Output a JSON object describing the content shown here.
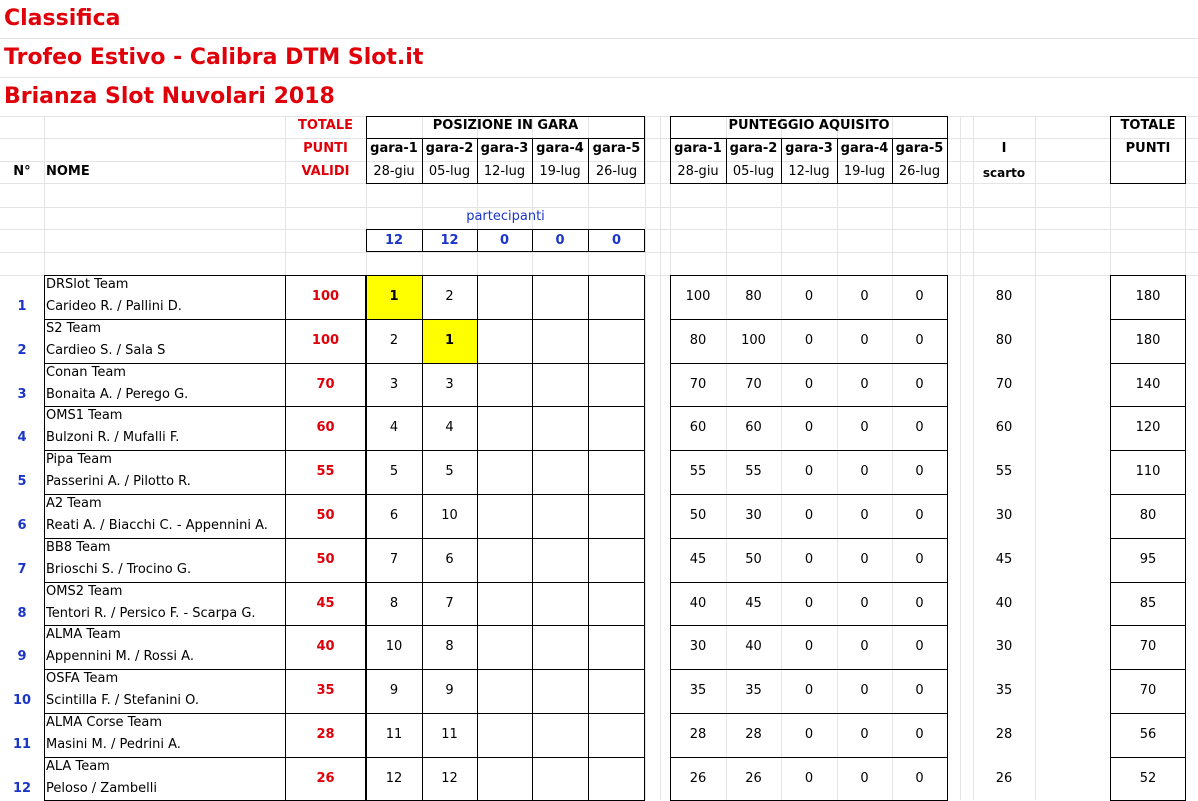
{
  "titles": [
    "Classifica",
    "Trofeo Estivo - Calibra DTM Slot.it",
    "Brianza Slot Nuvolari 2018"
  ],
  "header": {
    "totale": "TOTALE",
    "punti": "PUNTI",
    "validi": "VALIDI",
    "num": "N°",
    "nome": "NOME",
    "posizione": "POSIZIONE IN GARA",
    "punteggio": "PUNTEGGIO AQUISITO",
    "scarto_top": "I",
    "scarto": "scarto",
    "totale_punti_1": "TOTALE",
    "totale_punti_2": "PUNTI",
    "gare": [
      "gara-1",
      "gara-2",
      "gara-3",
      "gara-4",
      "gara-5"
    ],
    "dates": [
      "28-giu",
      "05-lug",
      "12-lug",
      "19-lug",
      "26-lug"
    ],
    "partecipanti_label": "partecipanti",
    "partecipanti": [
      "12",
      "12",
      "0",
      "0",
      "0"
    ]
  },
  "rows": [
    {
      "n": "1",
      "team": "DRSlot Team",
      "drivers": "Carideo R. / Pallini D.",
      "validi": "100",
      "pos": [
        "1",
        "2"
      ],
      "pts": [
        "100",
        "80",
        "0",
        "0",
        "0"
      ],
      "scarto": "80",
      "totale": "180"
    },
    {
      "n": "2",
      "team": "S2 Team",
      "drivers": "Cardieo S. / Sala S",
      "validi": "100",
      "pos": [
        "2",
        "1"
      ],
      "pts": [
        "80",
        "100",
        "0",
        "0",
        "0"
      ],
      "scarto": "80",
      "totale": "180"
    },
    {
      "n": "3",
      "team": "Conan Team",
      "drivers": "Bonaita A. / Perego G.",
      "validi": "70",
      "pos": [
        "3",
        "3"
      ],
      "pts": [
        "70",
        "70",
        "0",
        "0",
        "0"
      ],
      "scarto": "70",
      "totale": "140"
    },
    {
      "n": "4",
      "team": "OMS1 Team",
      "drivers": "Bulzoni R. / Mufalli F.",
      "validi": "60",
      "pos": [
        "4",
        "4"
      ],
      "pts": [
        "60",
        "60",
        "0",
        "0",
        "0"
      ],
      "scarto": "60",
      "totale": "120"
    },
    {
      "n": "5",
      "team": "Pipa Team",
      "drivers": "Passerini A. / Pilotto R.",
      "validi": "55",
      "pos": [
        "5",
        "5"
      ],
      "pts": [
        "55",
        "55",
        "0",
        "0",
        "0"
      ],
      "scarto": "55",
      "totale": "110"
    },
    {
      "n": "6",
      "team": "A2 Team",
      "drivers": "Reati A. / Biacchi C. - Appennini A.",
      "validi": "50",
      "pos": [
        "6",
        "10"
      ],
      "pts": [
        "50",
        "30",
        "0",
        "0",
        "0"
      ],
      "scarto": "30",
      "totale": "80"
    },
    {
      "n": "7",
      "team": "BB8 Team",
      "drivers": "Brioschi S. / Trocino G.",
      "validi": "50",
      "pos": [
        "7",
        "6"
      ],
      "pts": [
        "45",
        "50",
        "0",
        "0",
        "0"
      ],
      "scarto": "45",
      "totale": "95"
    },
    {
      "n": "8",
      "team": "OMS2 Team",
      "drivers": "Tentori R. / Persico F. - Scarpa G.",
      "validi": "45",
      "pos": [
        "8",
        "7"
      ],
      "pts": [
        "40",
        "45",
        "0",
        "0",
        "0"
      ],
      "scarto": "40",
      "totale": "85"
    },
    {
      "n": "9",
      "team": "ALMA Team",
      "drivers": "Appennini M. / Rossi A.",
      "validi": "40",
      "pos": [
        "10",
        "8"
      ],
      "pts": [
        "30",
        "40",
        "0",
        "0",
        "0"
      ],
      "scarto": "30",
      "totale": "70"
    },
    {
      "n": "10",
      "team": "OSFA Team",
      "drivers": "Scintilla F. / Stefanini O.",
      "validi": "35",
      "pos": [
        "9",
        "9"
      ],
      "pts": [
        "35",
        "35",
        "0",
        "0",
        "0"
      ],
      "scarto": "35",
      "totale": "70"
    },
    {
      "n": "11",
      "team": "ALMA Corse Team",
      "drivers": "Masini M. / Pedrini A.",
      "validi": "28",
      "pos": [
        "11",
        "11"
      ],
      "pts": [
        "28",
        "28",
        "0",
        "0",
        "0"
      ],
      "scarto": "28",
      "totale": "56"
    },
    {
      "n": "12",
      "team": "ALA Team",
      "drivers": "Peloso / Zambelli",
      "validi": "26",
      "pos": [
        "12",
        "12"
      ],
      "pts": [
        "26",
        "26",
        "0",
        "0",
        "0"
      ],
      "scarto": "26",
      "totale": "52"
    }
  ],
  "colors": {
    "title": "#e0000a",
    "validi": "#e0000a",
    "highlight": "#ffff00",
    "rank": "#1a35c8"
  }
}
